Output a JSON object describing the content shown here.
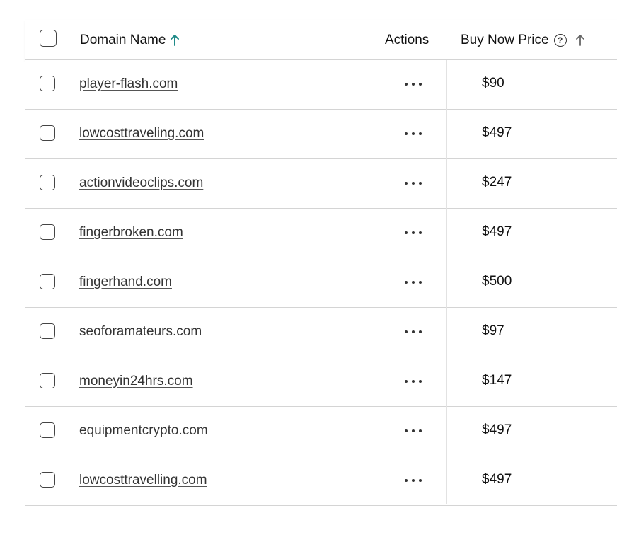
{
  "colors": {
    "sort_active": "#1f8a88",
    "sort_inactive": "#666666",
    "row_border": "#d4d4d4",
    "link_text": "#333333"
  },
  "header": {
    "domain_label": "Domain Name",
    "actions_label": "Actions",
    "price_label": "Buy Now Price",
    "help_icon": "help-circle-icon",
    "domain_sort_icon": "arrow-up-icon",
    "price_sort_icon": "arrow-up-icon"
  },
  "rows": [
    {
      "domain": "player-flash.com",
      "price": "$90"
    },
    {
      "domain": "lowcosttraveling.com",
      "price": "$497"
    },
    {
      "domain": "actionvideoclips.com",
      "price": "$247"
    },
    {
      "domain": "fingerbroken.com",
      "price": "$497"
    },
    {
      "domain": "fingerhand.com",
      "price": "$500"
    },
    {
      "domain": "seoforamateurs.com",
      "price": "$97"
    },
    {
      "domain": "moneyin24hrs.com",
      "price": "$147"
    },
    {
      "domain": "equipmentcrypto.com",
      "price": "$497"
    },
    {
      "domain": "lowcosttravelling.com",
      "price": "$497"
    }
  ]
}
